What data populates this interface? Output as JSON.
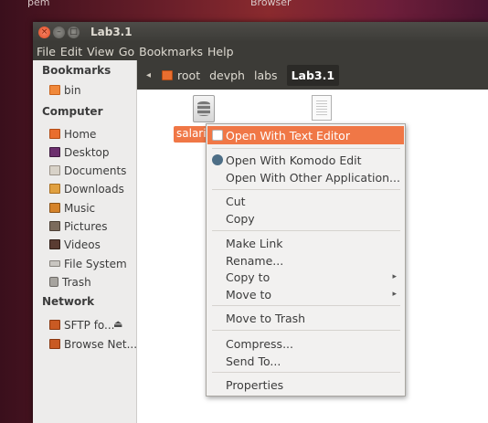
{
  "desktop": {
    "left_text": "pem",
    "right_text": "Browser"
  },
  "window": {
    "title": "Lab3.1",
    "controls": {
      "close": "×",
      "minimize": "–",
      "maximize": "□"
    }
  },
  "menubar": [
    "File",
    "Edit",
    "View",
    "Go",
    "Bookmarks",
    "Help"
  ],
  "sidebar": {
    "bookmarks_header": "Bookmarks",
    "bookmarks": [
      {
        "label": "bin",
        "icon": "folder-icon"
      }
    ],
    "computer_header": "Computer",
    "computer": [
      {
        "label": "Home",
        "icon": "home-folder-icon"
      },
      {
        "label": "Desktop",
        "icon": "desktop-icon"
      },
      {
        "label": "Documents",
        "icon": "documents-folder-icon"
      },
      {
        "label": "Downloads",
        "icon": "downloads-folder-icon"
      },
      {
        "label": "Music",
        "icon": "music-folder-icon"
      },
      {
        "label": "Pictures",
        "icon": "pictures-folder-icon"
      },
      {
        "label": "Videos",
        "icon": "videos-folder-icon"
      },
      {
        "label": "File System",
        "icon": "filesystem-icon"
      },
      {
        "label": "Trash",
        "icon": "trash-icon"
      }
    ],
    "network_header": "Network",
    "network": [
      {
        "label": "SFTP fo...",
        "icon": "network-drive-icon",
        "eject": "⏏"
      },
      {
        "label": "Browse Net...",
        "icon": "network-icon"
      }
    ]
  },
  "pathbar": {
    "back": "◂",
    "crumbs": [
      "root",
      "devph",
      "labs"
    ],
    "current": "Lab3.1"
  },
  "files": [
    {
      "label": "salari",
      "icon": "database-file-icon",
      "selected": true
    },
    {
      "label": "",
      "icon": "text-file-icon",
      "selected": false
    }
  ],
  "context_menu": {
    "items": [
      {
        "label": "Open With Text Editor",
        "highlighted": true,
        "icon": "text-editor-icon"
      },
      {
        "label": "Open With Komodo Edit",
        "icon": "komodo-icon"
      },
      {
        "label": "Open With Other Application..."
      },
      {
        "label": "Cut"
      },
      {
        "label": "Copy"
      },
      {
        "label": "Make Link"
      },
      {
        "label": "Rename..."
      },
      {
        "label": "Copy to",
        "submenu": true
      },
      {
        "label": "Move to",
        "submenu": true
      },
      {
        "label": "Move to Trash"
      },
      {
        "label": "Compress..."
      },
      {
        "label": "Send To..."
      },
      {
        "label": "Properties"
      }
    ],
    "submenu_arrow": "▸"
  },
  "colors": {
    "accent": "#f07746",
    "titlebar": "#3c3b37",
    "sidebar": "#edeceb"
  }
}
